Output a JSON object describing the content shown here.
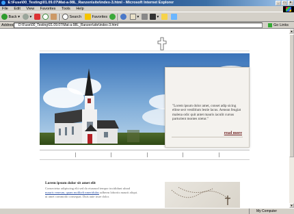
{
  "window": {
    "title": "E:\\Fuse\\00_Testing\\01.09.07\\Mat-a-98L_Ranzen\\site\\index-3.html - Microsoft Internet Explorer",
    "controls": [
      "_",
      "□",
      "×"
    ]
  },
  "menu": {
    "items": [
      "File",
      "Edit",
      "View",
      "Favorites",
      "Tools",
      "Help"
    ]
  },
  "toolbar": {
    "back_label": "Back",
    "search_label": "Search",
    "favorites_label": "Favorites"
  },
  "address": {
    "label": "Address",
    "value": "D:\\Fuse\\00_Testing\\01.09.07\\Mat-a-98L_Ranzen\\site\\index-3.html",
    "go_label": "Go",
    "links_label": "Links"
  },
  "hero": {
    "quote": "\"Lorem ipsum dolor amet, conset adip sicing elitse sect vestiblum lestie lacus. Aenean feugiat malena odic quit antet mauris iaculit cursus parturient montes nietur.\"",
    "read_more": "read more"
  },
  "section": {
    "title": "Lorem ipsum dolor sit amet elit",
    "line1": "Consectetur adipiscing elit sed do eiusmod tempor incididunt ulnad",
    "line2_link": "mauris veneum, quam molikelt nmeridulus",
    "line2_rest": " udberm lobortis maurit aliqui.",
    "line3": "ut amet commodo consequat. Duis aute irure dolor."
  },
  "status": {
    "left": "",
    "zone": "My Computer"
  },
  "colors": {
    "titlebar": "#0a246a",
    "read_more": "#6b1a1a",
    "link": "#2a4ea0"
  }
}
